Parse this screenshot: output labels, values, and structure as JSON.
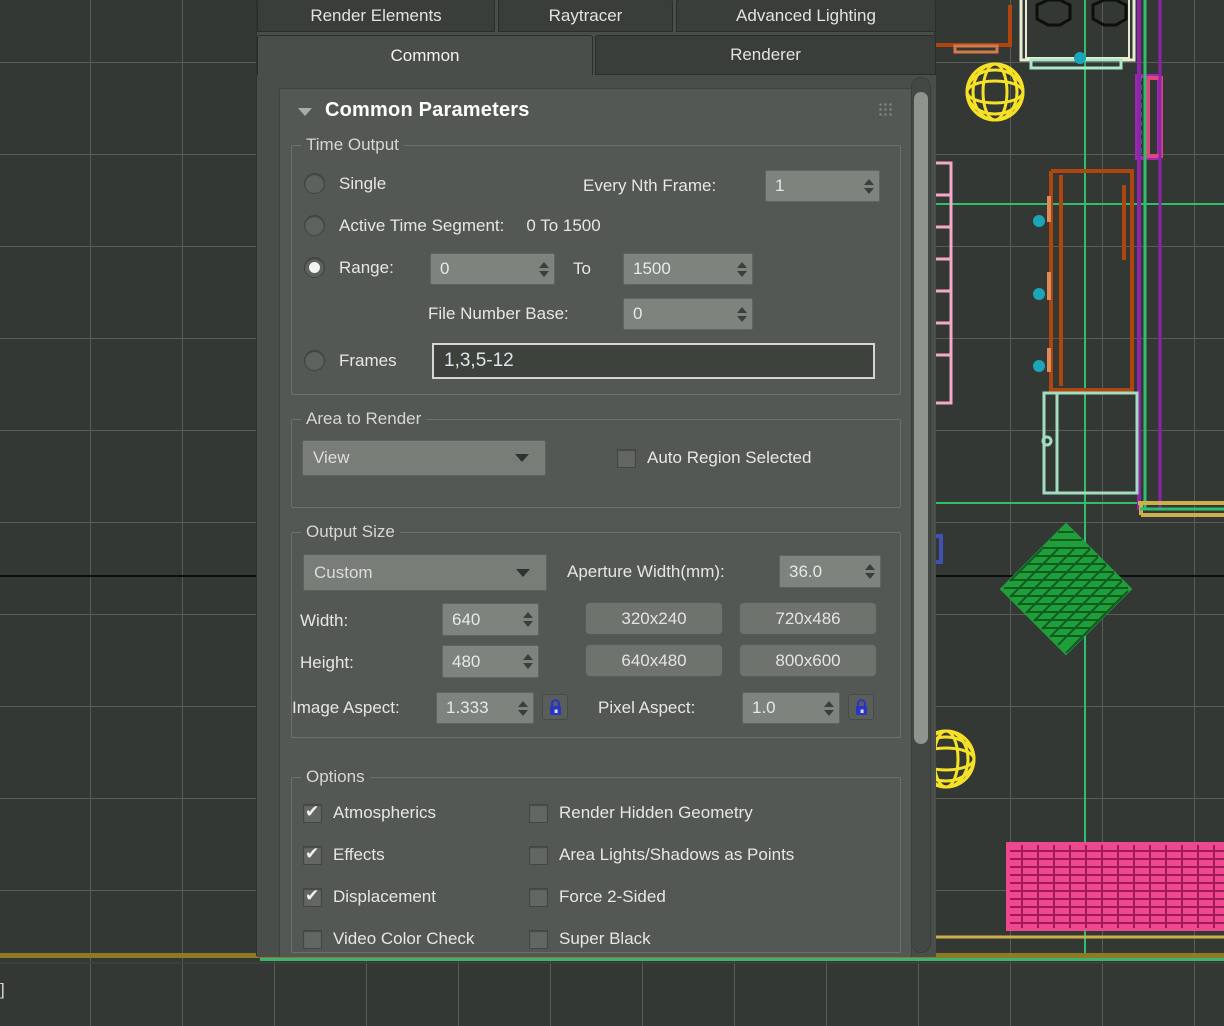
{
  "viewport": {
    "label": "e]",
    "grid_color": "#585d58",
    "bg_color": "#343834"
  },
  "panel": {
    "tabs_top": [
      {
        "label": "Render Elements",
        "active": false
      },
      {
        "label": "Raytracer",
        "active": false
      },
      {
        "label": "Advanced Lighting",
        "active": false
      }
    ],
    "tabs_bottom": [
      {
        "label": "Common",
        "active": true
      },
      {
        "label": "Renderer",
        "active": false
      }
    ],
    "rollout": {
      "title": "Common Parameters",
      "expanded": true
    },
    "time_output": {
      "group_label": "Time Output",
      "single_label": "Single",
      "single_selected": false,
      "active_time_segment_label": "Active Time Segment:",
      "active_time_segment_value": "0 To 1500",
      "active_time_segment_selected": false,
      "range_label": "Range:",
      "range_selected": true,
      "range_from": "0",
      "range_to_label": "To",
      "range_to": "1500",
      "every_nth_frame_label": "Every Nth Frame:",
      "every_nth_frame": "1",
      "file_number_base_label": "File Number Base:",
      "file_number_base": "0",
      "frames_label": "Frames",
      "frames_selected": false,
      "frames_value": "1,3,5-12"
    },
    "area_to_render": {
      "group_label": "Area to Render",
      "selected": "View",
      "auto_region_label": "Auto Region Selected",
      "auto_region_checked": false
    },
    "output_size": {
      "group_label": "Output Size",
      "preset_selected": "Custom",
      "aperture_label": "Aperture Width(mm):",
      "aperture_value": "36.0",
      "width_label": "Width:",
      "width_value": "640",
      "height_label": "Height:",
      "height_value": "480",
      "presets": [
        "320x240",
        "720x486",
        "640x480",
        "800x600"
      ],
      "image_aspect_label": "Image Aspect:",
      "image_aspect_value": "1.333",
      "pixel_aspect_label": "Pixel Aspect:",
      "pixel_aspect_value": "1.0",
      "image_aspect_locked": true,
      "pixel_aspect_locked": true
    },
    "options": {
      "group_label": "Options",
      "left": [
        {
          "label": "Atmospherics",
          "checked": true
        },
        {
          "label": "Effects",
          "checked": true
        },
        {
          "label": "Displacement",
          "checked": true
        },
        {
          "label": "Video Color Check",
          "checked": false
        }
      ],
      "right": [
        {
          "label": "Render Hidden Geometry",
          "checked": false
        },
        {
          "label": "Area Lights/Shadows as Points",
          "checked": false
        },
        {
          "label": "Force 2-Sided",
          "checked": false
        },
        {
          "label": "Super Black",
          "checked": false
        }
      ]
    }
  }
}
